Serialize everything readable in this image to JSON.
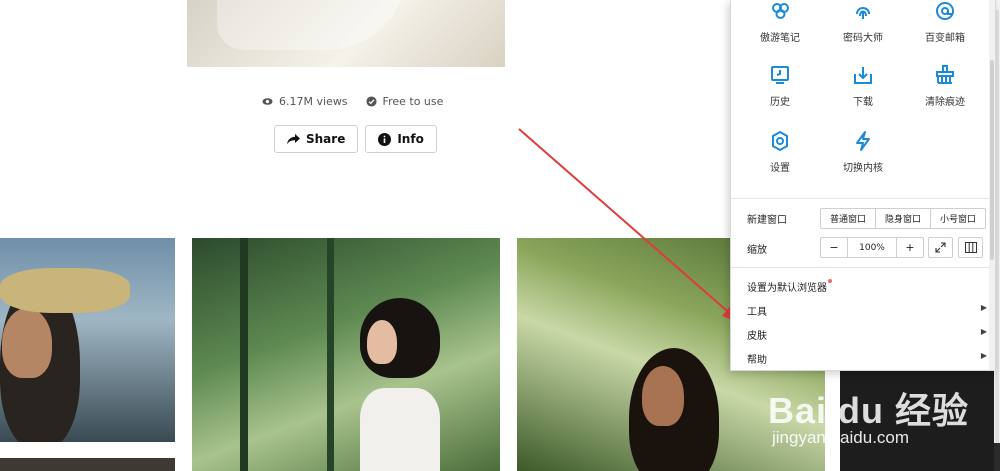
{
  "page": {
    "views": "6.17M views",
    "license": "Free to use",
    "share_label": "Share",
    "info_label": "Info"
  },
  "watermark": {
    "logo": "Bai du 经验",
    "url": "jingyan.baidu.com"
  },
  "menu": {
    "grid_row1": [
      "傲游笔记",
      "密码大师",
      "百变邮箱"
    ],
    "grid_row2": [
      "历史",
      "下载",
      "清除痕迹"
    ],
    "grid_row3": [
      "设置",
      "切换内核"
    ],
    "new_window": {
      "label": "新建窗口",
      "options": [
        "普通窗口",
        "隐身窗口",
        "小号窗口"
      ]
    },
    "zoom": {
      "label": "缩放",
      "minus": "−",
      "value": "100%",
      "plus": "+"
    },
    "default_browser": "设置为默认浏览器",
    "items": [
      "工具",
      "皮肤",
      "帮助"
    ],
    "accent_color": "#1a8ad9"
  }
}
